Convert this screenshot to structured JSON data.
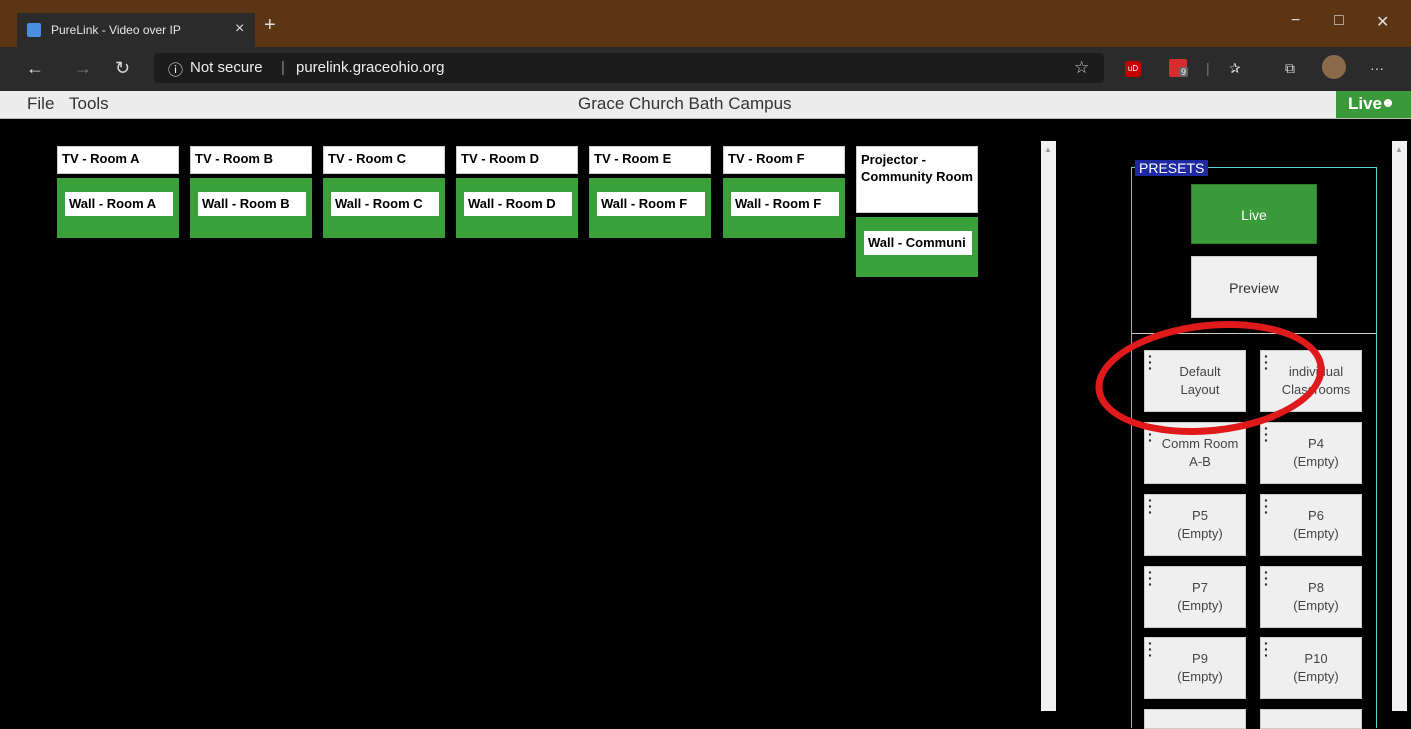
{
  "browser": {
    "tab_title": "PureLink - Video over IP",
    "tab_close": "×",
    "new_tab": "+",
    "window_controls": {
      "minimize": "−",
      "maximize": "□",
      "close": "✕"
    },
    "nav": {
      "back": "←",
      "forward": "→",
      "reload": "↻"
    },
    "info_icon": "ⓘ",
    "security_text": "Not secure",
    "url": "purelink.graceohio.org",
    "extensions": {
      "ublock": "uD",
      "badge_count": "9"
    },
    "toolbar": {
      "favorites_star": "☆",
      "favorites": "✰",
      "collections": "⧉",
      "more": "···"
    }
  },
  "app": {
    "menu": [
      "File",
      "Tools"
    ],
    "campus_title": "Grace Church Bath Campus",
    "live_status": "Live",
    "displays": [
      {
        "tv": "TV - Room A",
        "wall": "Wall - Room A"
      },
      {
        "tv": "TV - Room B",
        "wall": "Wall - Room B"
      },
      {
        "tv": "TV - Room C",
        "wall": "Wall - Room C"
      },
      {
        "tv": "TV - Room D",
        "wall": "Wall - Room D"
      },
      {
        "tv": "TV - Room E",
        "wall": "Wall - Room F"
      },
      {
        "tv": "TV - Room F",
        "wall": "Wall - Room F"
      },
      {
        "tv": "Projector - Community Room",
        "wall": "Wall - Communi"
      }
    ],
    "presets": {
      "legend": "PRESETS",
      "live_button": "Live",
      "preview_button": "Preview",
      "items": [
        {
          "line1": "Default",
          "line2": "Layout"
        },
        {
          "line1": "individual",
          "line2": "Classrooms"
        },
        {
          "line1": "Comm Room",
          "line2": "A-B"
        },
        {
          "line1": "P4",
          "line2": "(Empty)"
        },
        {
          "line1": "P5",
          "line2": "(Empty)"
        },
        {
          "line1": "P6",
          "line2": "(Empty)"
        },
        {
          "line1": "P7",
          "line2": "(Empty)"
        },
        {
          "line1": "P8",
          "line2": "(Empty)"
        },
        {
          "line1": "P9",
          "line2": "(Empty)"
        },
        {
          "line1": "P10",
          "line2": "(Empty)"
        }
      ]
    }
  },
  "colors": {
    "tabbar": "#5b3514",
    "green": "#3aa03a",
    "annotation_red": "#e01a1a",
    "presets_border": "#5ad1d1"
  }
}
